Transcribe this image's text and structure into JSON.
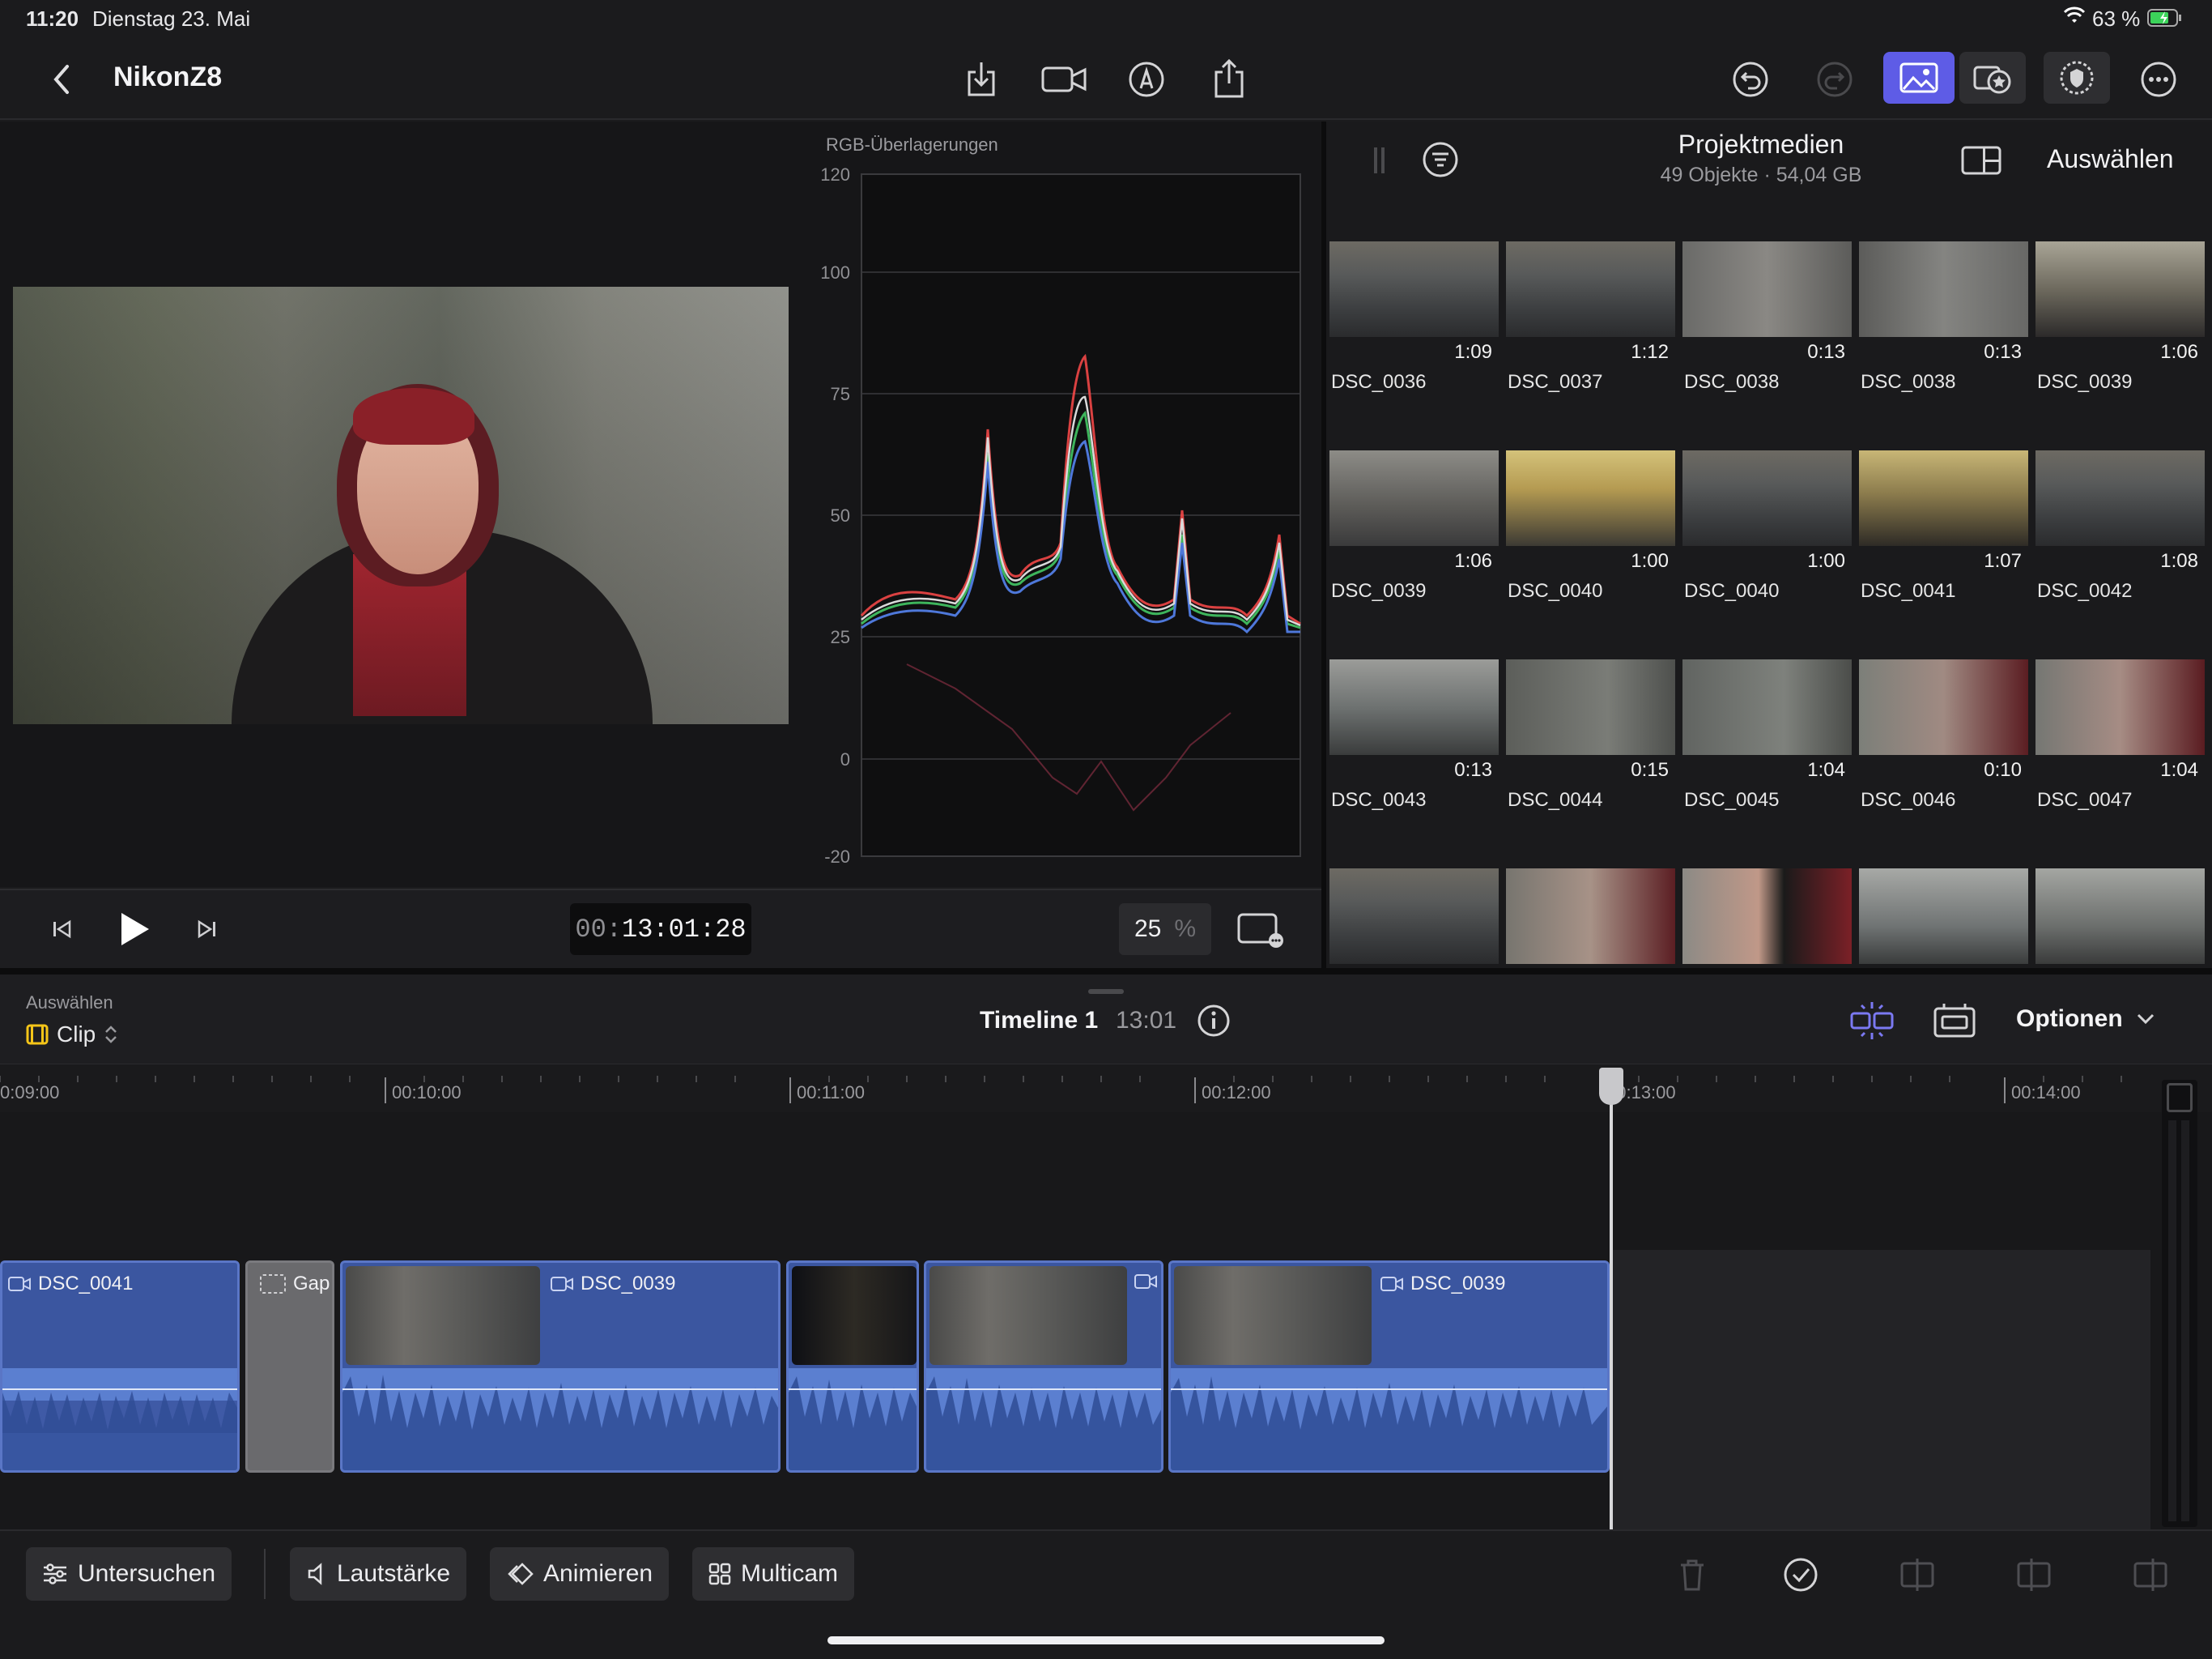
{
  "status": {
    "time": "11:20",
    "date": "Dienstag 23. Mai",
    "battery": "63 %"
  },
  "topbar": {
    "title": "NikonZ8"
  },
  "scope": {
    "title": "RGB-Überlagerungen",
    "ticks": [
      "120",
      "100",
      "75",
      "50",
      "25",
      "0",
      "-20"
    ]
  },
  "browser": {
    "title": "Projektmedien",
    "subtitle": "49 Objekte · 54,04 GB",
    "select_label": "Auswählen",
    "items": [
      {
        "name": "DSC_0036",
        "dur": "1:09"
      },
      {
        "name": "DSC_0037",
        "dur": "1:12"
      },
      {
        "name": "DSC_0038",
        "dur": "0:13"
      },
      {
        "name": "DSC_0038",
        "dur": "0:13"
      },
      {
        "name": "DSC_0039",
        "dur": "1:06"
      },
      {
        "name": "DSC_0039",
        "dur": "1:06"
      },
      {
        "name": "DSC_0040",
        "dur": "1:00"
      },
      {
        "name": "DSC_0040",
        "dur": "1:00"
      },
      {
        "name": "DSC_0041",
        "dur": "1:07"
      },
      {
        "name": "DSC_0042",
        "dur": "1:08"
      },
      {
        "name": "DSC_0043",
        "dur": "0:13"
      },
      {
        "name": "DSC_0044",
        "dur": "0:15"
      },
      {
        "name": "DSC_0045",
        "dur": "1:04"
      },
      {
        "name": "DSC_0046",
        "dur": "0:10"
      },
      {
        "name": "DSC_0047",
        "dur": "1:04"
      }
    ]
  },
  "transport": {
    "timecode_dim": "00:",
    "timecode": "13:01:28",
    "zoom": "25",
    "zoom_unit": "%"
  },
  "timeline": {
    "select_label": "Auswählen",
    "mode": "Clip",
    "title": "Timeline 1",
    "duration": "13:01",
    "options_label": "Optionen",
    "ruler": [
      "0:09:00",
      "00:10:00",
      "00:11:00",
      "00:12:00",
      "00:13:00",
      "00:14:00"
    ],
    "clips": [
      "DSC_0041",
      "Gap",
      "DSC_0039",
      "DSC_0039"
    ]
  },
  "bottom": {
    "inspect": "Untersuchen",
    "volume": "Lautstärke",
    "animate": "Animieren",
    "multicam": "Multicam"
  },
  "colors": {
    "accent": "#5e5ce6",
    "clip": "#3f5aa6",
    "audio": "#5b7fd0"
  }
}
